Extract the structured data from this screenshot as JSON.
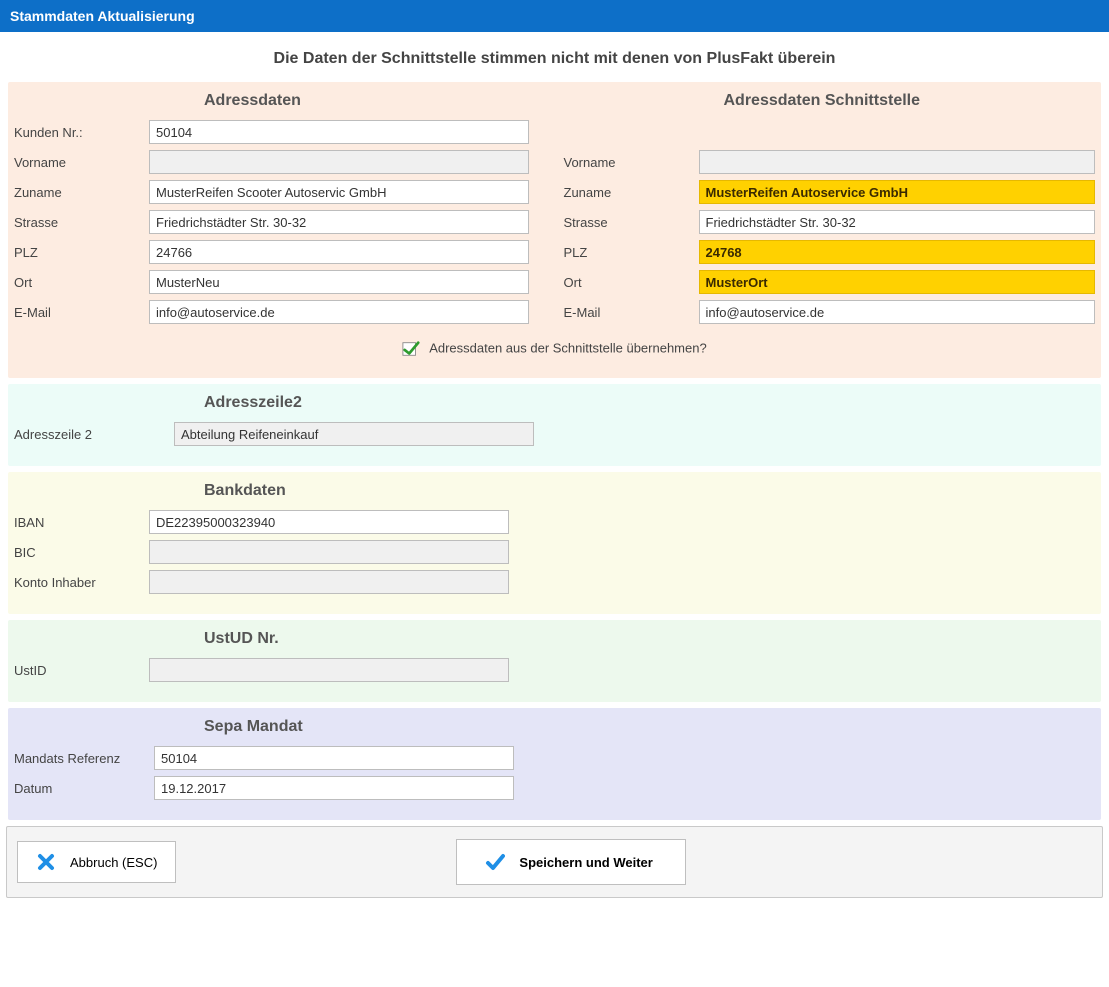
{
  "window": {
    "title": "Stammdaten Aktualisierung"
  },
  "mismatch_heading": "Die Daten der Schnittstelle stimmen nicht mit denen von PlusFakt überein",
  "address": {
    "heading_left": "Adressdaten",
    "heading_right": "Adressdaten Schnittstelle",
    "labels": {
      "kundennr": "Kunden Nr.:",
      "vorname": "Vorname",
      "zuname": "Zuname",
      "strasse": "Strasse",
      "plz": "PLZ",
      "ort": "Ort",
      "email": "E-Mail"
    },
    "left": {
      "kundennr": "50104",
      "vorname": "",
      "zuname": "MusterReifen Scooter Autoservic GmbH",
      "strasse": "Friedrichstädter Str. 30-32",
      "plz": "24766",
      "ort": "MusterNeu",
      "email": "info@autoservice.de"
    },
    "right": {
      "vorname": "",
      "zuname": "MusterReifen Autoservice GmbH",
      "strasse": "Friedrichstädter Str. 30-32",
      "plz": "24768",
      "ort": "MusterOrt",
      "email": "info@autoservice.de"
    },
    "checkbox_label": "Adressdaten aus der Schnittstelle übernehmen?",
    "highlighted_fields": [
      "zuname",
      "plz",
      "ort"
    ]
  },
  "address2": {
    "heading": "Adresszeile2",
    "label": "Adresszeile 2",
    "value": "Abteilung Reifeneinkauf"
  },
  "bank": {
    "heading": "Bankdaten",
    "labels": {
      "iban": "IBAN",
      "bic": "BIC",
      "inhaber": "Konto Inhaber"
    },
    "values": {
      "iban": "DE22395000323940",
      "bic": "",
      "inhaber": ""
    }
  },
  "ust": {
    "heading": "UstUD Nr.",
    "label": "UstID",
    "value": ""
  },
  "sepa": {
    "heading": "Sepa Mandat",
    "labels": {
      "ref": "Mandats Referenz",
      "datum": "Datum"
    },
    "values": {
      "ref": "50104",
      "datum": "19.12.2017"
    }
  },
  "buttons": {
    "cancel": "Abbruch (ESC)",
    "save": "Speichern und Weiter"
  }
}
